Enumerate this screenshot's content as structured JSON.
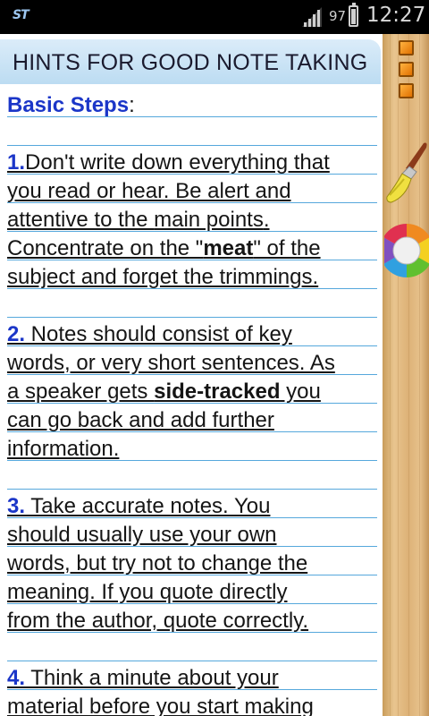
{
  "status_bar": {
    "app_icon_label": "ST",
    "battery_percent": "97",
    "time": "12:27"
  },
  "title": "HINTS FOR GOOD NOTE TAKING",
  "side_panel": {
    "icons": [
      "menu-tab-icon",
      "menu-tab-icon",
      "menu-tab-icon",
      "paintbrush-icon",
      "color-palette-icon"
    ]
  },
  "notes": {
    "heading": "Basic Steps",
    "heading_suffix": ":",
    "items": [
      {
        "number": "1.",
        "lines": [
          [
            "Don't write down everything that"
          ],
          [
            "you read or hear. Be alert and"
          ],
          [
            "attentive to the ",
            "main points",
            "."
          ],
          [
            "Concentrate on the \"",
            "meat",
            "\" of the"
          ],
          [
            "subject and forget the trimmings."
          ]
        ]
      },
      {
        "number": "2.",
        "lines": [
          [
            " Notes should consist of key"
          ],
          [
            "words, or very short sentences. As"
          ],
          [
            "a speaker gets ",
            "side-tracked",
            " you"
          ],
          [
            "can go back and add further"
          ],
          [
            "information."
          ]
        ]
      },
      {
        "number": "3.",
        "lines": [
          [
            " Take accurate notes. You"
          ],
          [
            "should usually use your own"
          ],
          [
            "words, but try not to change the"
          ],
          [
            "meaning. If you quote directly"
          ],
          [
            "from the author, quote correctly."
          ]
        ]
      },
      {
        "number": "4.",
        "lines": [
          [
            " Think a minute about your"
          ],
          [
            "material before you start making"
          ]
        ]
      }
    ]
  }
}
